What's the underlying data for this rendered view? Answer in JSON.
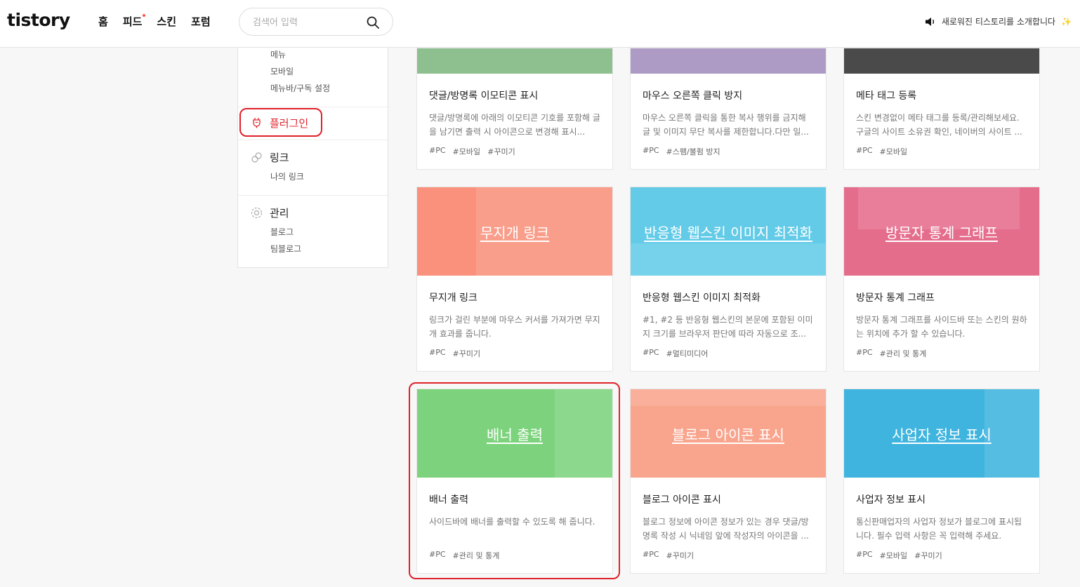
{
  "header": {
    "logo": "tistory",
    "nav": [
      {
        "label": "홈"
      },
      {
        "label": "피드"
      },
      {
        "label": "스킨"
      },
      {
        "label": "포럼"
      }
    ],
    "search_placeholder": "검색어 입력",
    "notice": "새로워진 티스토리를 소개합니다"
  },
  "sidebar": {
    "top_items": [
      "메뉴",
      "모바일",
      "메뉴바/구독 설정"
    ],
    "plugin": "플러그인",
    "link": {
      "title": "링크",
      "items": [
        "나의 링크"
      ]
    },
    "manage": {
      "title": "관리",
      "items": [
        "블로그",
        "팀블로그"
      ]
    }
  },
  "colors": {
    "accent": "#e0262f",
    "highlight_border": "#e0202a"
  },
  "cards": [
    {
      "title": "댓글/방명록 이모티콘 표시",
      "desc": "댓글/방명록에 아래의 이모티콘 기호를 포함해 글을 남기면 출력 시 아이콘으로 변경해 표시...",
      "tags": [
        "#PC",
        "#모바일",
        "#꾸미기"
      ],
      "color": "#8dbf8f"
    },
    {
      "title": "마우스 오른쪽 클릭 방지",
      "desc": "마우스 오른쪽 클릭을 통한 복사 행위를 금지해 글 및 이미지 무단 복사를 제한합니다.다만 일...",
      "tags": [
        "#PC",
        "#스팸/불펌 방지"
      ],
      "color": "#ad9bc6"
    },
    {
      "title": "메타 태그 등록",
      "desc": "스킨 변경없이 메타 태그를 등록/관리해보세요. 구글의 사이트 소유권 확인, 네이버의 사이트 ...",
      "tags": [
        "#PC",
        "#모바일"
      ],
      "color": "#4a4a4a"
    },
    {
      "title": "무지개 링크",
      "thumb": "무지개 링크",
      "desc": "링크가 걸린 부분에 마우스 커서를 가져가면 무지개 효과를 줍니다.",
      "tags": [
        "#PC",
        "#꾸미기"
      ],
      "color": "#f9917c"
    },
    {
      "title": "반응형 웹스킨 이미지 최적화",
      "thumb": "반응형 웹스킨 이미지 최적화",
      "desc": "#1, #2 등 반응형 웹스킨의 본문에 포함된 이미지 크기를 브라우저 판단에 따라 자동으로 조...",
      "tags": [
        "#PC",
        "#멀티미디어"
      ],
      "color": "#63cbe8"
    },
    {
      "title": "방문자 통계 그래프",
      "thumb": "방문자 통계 그래프",
      "desc": "방문자 통계 그래프를 사이드바 또는 스킨의 원하는 위치에 추가 할 수 있습니다.",
      "tags": [
        "#PC",
        "#관리 및 통계"
      ],
      "color": "#e56d8c"
    },
    {
      "title": "배너 출력",
      "thumb": "배너 출력",
      "desc": "사이드바에 배너를 출력할 수 있도록 해 줍니다.",
      "tags": [
        "#PC",
        "#관리 및 통계"
      ],
      "color": "#7dd37d"
    },
    {
      "title": "블로그 아이콘 표시",
      "thumb": "블로그 아이콘 표시",
      "desc": "블로그 정보에 아이콘 정보가 있는 경우 댓글/방명록 작성 시 닉네임 앞에 작성자의 아이콘을 ...",
      "tags": [
        "#PC",
        "#꾸미기"
      ],
      "color": "#f9a48d"
    },
    {
      "title": "사업자 정보 표시",
      "thumb": "사업자 정보 표시",
      "desc": "통신판매업자의 사업자 정보가 블로그에 표시됩니다. 필수 입력 사항은 꼭 입력해 주세요.",
      "tags": [
        "#PC",
        "#모바일",
        "#꾸미기"
      ],
      "color": "#3fb4de"
    }
  ]
}
